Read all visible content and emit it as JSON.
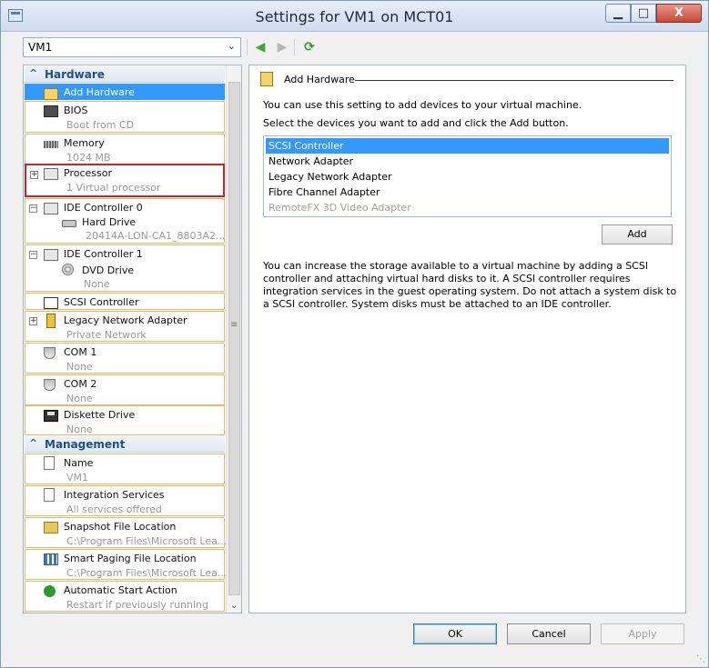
{
  "window": {
    "title": "Settings for VM1 on MCT01",
    "minimize": "▁",
    "maximize": "□",
    "close": "X"
  },
  "vm_selector": {
    "value": "VM1"
  },
  "tree": {
    "hardware_header": "Hardware",
    "management_header": "Management",
    "items": {
      "add_hardware": {
        "label": "Add Hardware"
      },
      "bios": {
        "label": "BIOS",
        "sub": "Boot from CD"
      },
      "memory": {
        "label": "Memory",
        "sub": "1024 MB"
      },
      "processor": {
        "label": "Processor",
        "sub": "1 Virtual processor"
      },
      "ide0": {
        "label": "IDE Controller 0"
      },
      "hard_drive": {
        "label": "Hard Drive",
        "sub": "20414A-LON-CA1_8803A2..."
      },
      "ide1": {
        "label": "IDE Controller 1"
      },
      "dvd": {
        "label": "DVD Drive",
        "sub": "None"
      },
      "scsi": {
        "label": "SCSI Controller"
      },
      "legacy_nic": {
        "label": "Legacy Network Adapter",
        "sub": "Private Network"
      },
      "com1": {
        "label": "COM 1",
        "sub": "None"
      },
      "com2": {
        "label": "COM 2",
        "sub": "None"
      },
      "diskette": {
        "label": "Diskette Drive",
        "sub": "None"
      },
      "name": {
        "label": "Name",
        "sub": "VM1"
      },
      "integration": {
        "label": "Integration Services",
        "sub": "All services offered"
      },
      "snapshot": {
        "label": "Snapshot File Location",
        "sub": "C:\\Program Files\\Microsoft Lea..."
      },
      "paging": {
        "label": "Smart Paging File Location",
        "sub": "C:\\Program Files\\Microsoft Lea..."
      },
      "autostart": {
        "label": "Automatic Start Action",
        "sub": "Restart if previously running"
      }
    }
  },
  "details": {
    "title": "Add Hardware",
    "intro": "You can use this setting to add devices to your virtual machine.",
    "select_label": "Select the devices you want to add and click the Add button.",
    "devices": [
      "SCSI Controller",
      "Network Adapter",
      "Legacy Network Adapter",
      "Fibre Channel Adapter",
      "RemoteFX 3D Video Adapter"
    ],
    "add_button": "Add",
    "info": "You can increase the storage available to a virtual machine by adding a SCSI controller and attaching virtual hard disks to it. A SCSI controller requires integration services in the guest operating system. Do not attach a system disk to a SCSI controller. System disks must be attached to an IDE controller."
  },
  "buttons": {
    "ok": "OK",
    "cancel": "Cancel",
    "apply": "Apply"
  }
}
